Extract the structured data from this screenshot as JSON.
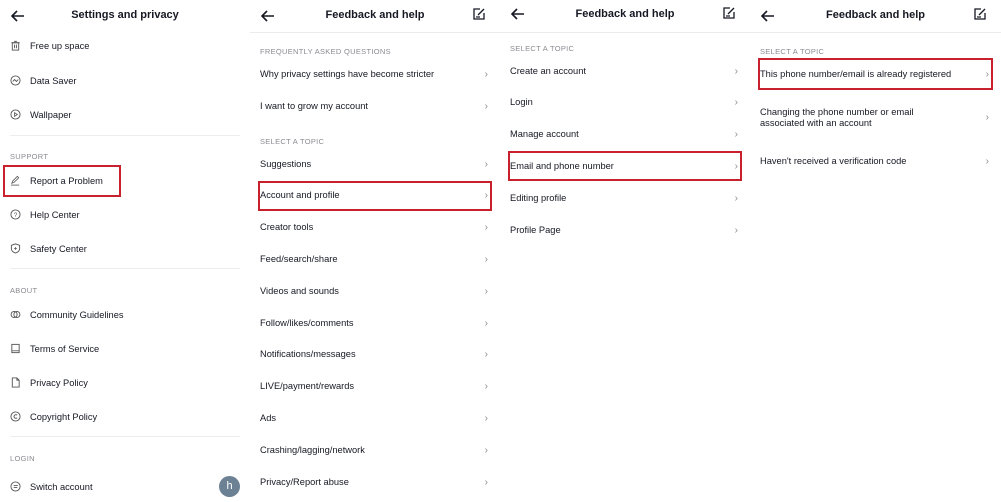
{
  "panels": {
    "settings": {
      "title": "Settings and privacy",
      "top_items": [
        {
          "label": "Free up space",
          "icon": "trash-icon"
        },
        {
          "label": "Data Saver",
          "icon": "data-saver-icon"
        },
        {
          "label": "Wallpaper",
          "icon": "play-circle-icon"
        }
      ],
      "support_header": "SUPPORT",
      "support_items": [
        {
          "label": "Report a Problem",
          "icon": "pencil-icon",
          "highlighted": true
        },
        {
          "label": "Help Center",
          "icon": "question-circle-icon"
        },
        {
          "label": "Safety Center",
          "icon": "shield-icon"
        }
      ],
      "about_header": "ABOUT",
      "about_items": [
        {
          "label": "Community Guidelines",
          "icon": "guidelines-icon"
        },
        {
          "label": "Terms of Service",
          "icon": "book-icon"
        },
        {
          "label": "Privacy Policy",
          "icon": "document-icon"
        },
        {
          "label": "Copyright Policy",
          "icon": "copyright-icon"
        }
      ],
      "login_header": "LOGIN",
      "login_items": [
        {
          "label": "Switch account",
          "icon": "switch-icon"
        }
      ],
      "avatar_letter": "h"
    },
    "feedback": {
      "title": "Feedback and help",
      "faq_header": "FREQUENTLY ASKED QUESTIONS",
      "faq_items": [
        "Why privacy settings have become stricter",
        "I want to grow my account"
      ],
      "topic_header": "SELECT A TOPIC",
      "topics": [
        "Suggestions",
        "Account and profile",
        "Creator tools",
        "Feed/search/share",
        "Videos and sounds",
        "Follow/likes/comments",
        "Notifications/messages",
        "LIVE/payment/rewards",
        "Ads",
        "Crashing/lagging/network",
        "Privacy/Report abuse"
      ],
      "highlighted": "Account and profile"
    },
    "account": {
      "title": "Feedback and help",
      "topic_header": "SELECT A TOPIC",
      "topics": [
        "Create an account",
        "Login",
        "Manage account",
        "Email and phone number",
        "Editing profile",
        "Profile Page"
      ],
      "highlighted": "Email and phone number"
    },
    "email": {
      "title": "Feedback and help",
      "topic_header": "SELECT A TOPIC",
      "topics": [
        "This phone number/email is already registered",
        "Changing the phone number or email associated with an account",
        "Haven't received a verification code"
      ],
      "highlighted": "This phone number/email is already registered"
    }
  },
  "colors": {
    "highlight": "#c8202c",
    "avatar": "#6c8194"
  },
  "chevron": "›"
}
